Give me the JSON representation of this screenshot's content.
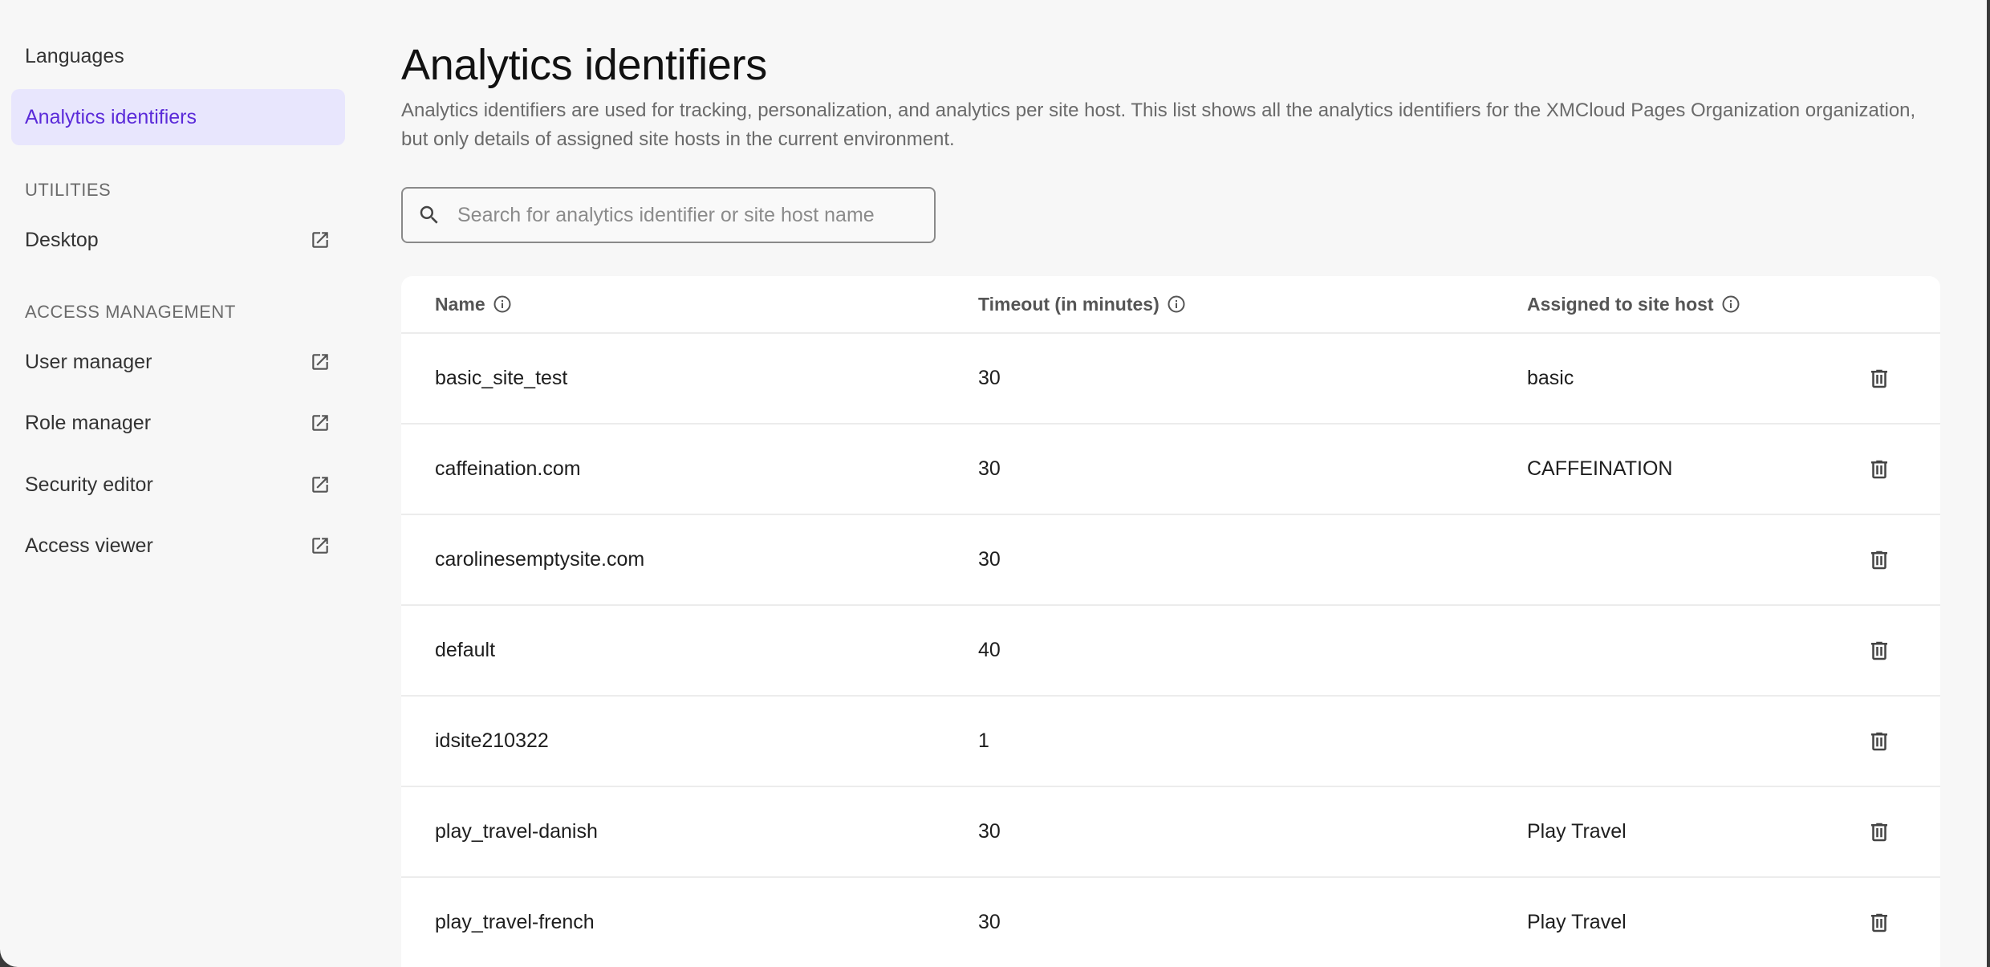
{
  "sidebar": {
    "top_items": [
      {
        "label": "Languages",
        "active": false
      },
      {
        "label": "Analytics identifiers",
        "active": true
      }
    ],
    "sections": [
      {
        "title": "UTILITIES",
        "items": [
          {
            "label": "Desktop",
            "icon": "external-link-icon"
          }
        ]
      },
      {
        "title": "ACCESS MANAGEMENT",
        "items": [
          {
            "label": "User manager",
            "icon": "external-link-icon"
          },
          {
            "label": "Role manager",
            "icon": "external-link-icon"
          },
          {
            "label": "Security editor",
            "icon": "external-link-icon"
          },
          {
            "label": "Access viewer",
            "icon": "external-link-icon"
          }
        ]
      }
    ]
  },
  "page": {
    "title": "Analytics identifiers",
    "description": "Analytics identifiers are used for tracking, personalization, and analytics per site host. This list shows all the analytics identifiers for the XMCloud Pages Organization organization, but only details of assigned site hosts in the current environment."
  },
  "search": {
    "placeholder": "Search for analytics identifier or site host name",
    "value": "",
    "icon": "search-icon"
  },
  "table": {
    "columns": {
      "name": "Name",
      "timeout": "Timeout (in minutes)",
      "site_host": "Assigned to site host"
    },
    "rows": [
      {
        "name": "basic_site_test",
        "timeout": "30",
        "site_host": "basic"
      },
      {
        "name": "caffeination.com",
        "timeout": "30",
        "site_host": "CAFFEINATION"
      },
      {
        "name": "carolinesemptysite.com",
        "timeout": "30",
        "site_host": ""
      },
      {
        "name": "default",
        "timeout": "40",
        "site_host": ""
      },
      {
        "name": "idsite210322",
        "timeout": "1",
        "site_host": ""
      },
      {
        "name": "play_travel-danish",
        "timeout": "30",
        "site_host": "Play Travel"
      },
      {
        "name": "play_travel-french",
        "timeout": "30",
        "site_host": "Play Travel"
      }
    ]
  },
  "colors": {
    "accent": "#5b2bd9",
    "active_bg": "#e8e6fd",
    "background": "#f7f7f7"
  }
}
